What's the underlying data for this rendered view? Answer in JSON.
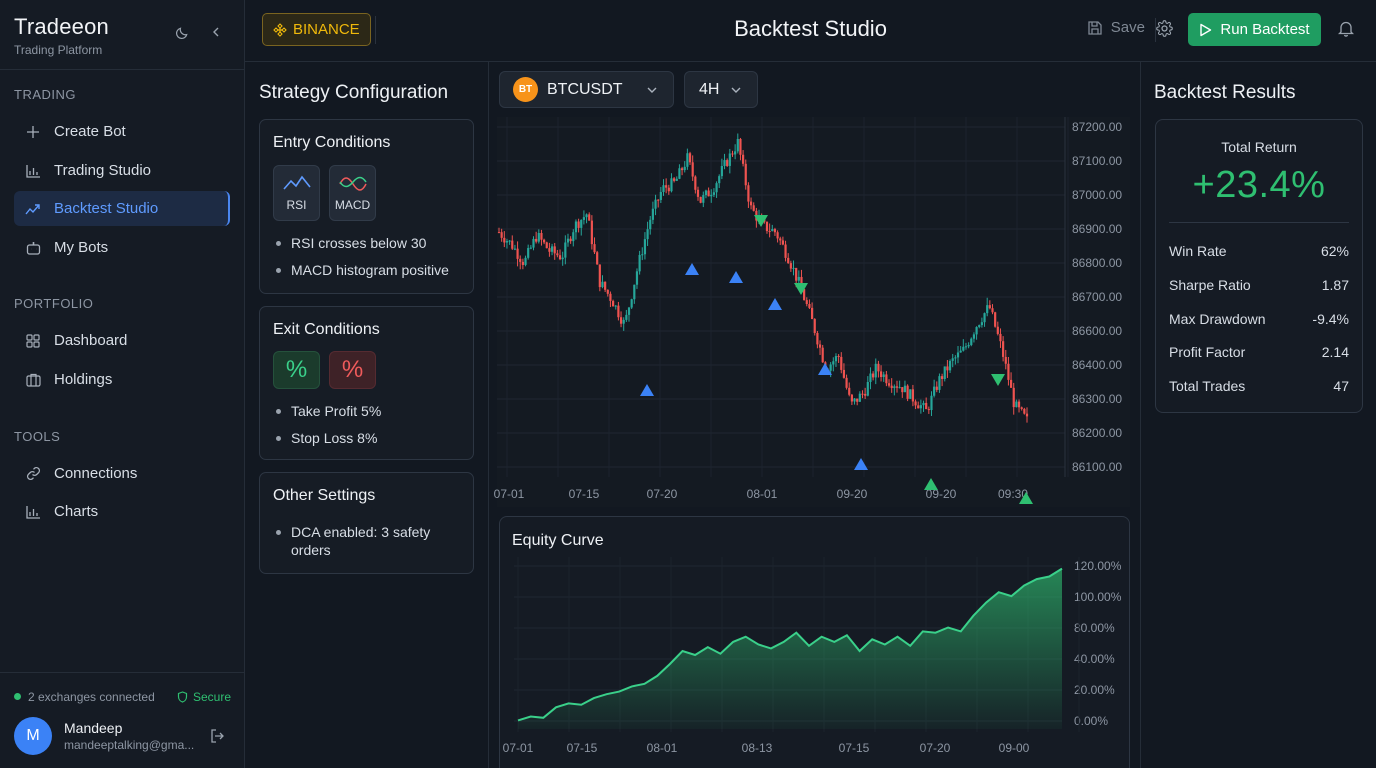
{
  "brand": {
    "name": "Tradeeon",
    "subtitle": "Trading Platform"
  },
  "sidebar": {
    "sections": [
      {
        "label": "TRADING"
      },
      {
        "label": "PORTFOLIO"
      },
      {
        "label": "TOOLS"
      }
    ],
    "items": [
      {
        "label": "Create Bot",
        "icon": "plus-icon"
      },
      {
        "label": "Trading Studio",
        "icon": "bar-chart-icon"
      },
      {
        "label": "Backtest Studio",
        "icon": "trend-line-icon",
        "active": true
      },
      {
        "label": "My Bots",
        "icon": "robot-icon"
      },
      {
        "label": "Dashboard",
        "icon": "grid-icon"
      },
      {
        "label": "Holdings",
        "icon": "wallet-icon"
      },
      {
        "label": "Connections",
        "icon": "link-icon"
      },
      {
        "label": "Charts",
        "icon": "bar-chart-icon"
      }
    ],
    "footer": {
      "connections": "2 exchanges connected",
      "secure": "Secure",
      "user": {
        "initial": "M",
        "name": "Mandeep",
        "email": "mandeeptalking@gma..."
      }
    }
  },
  "header": {
    "exchange": "BINANCE",
    "title": "Backtest Studio",
    "save_label": "Save",
    "run_label": "Run Backtest"
  },
  "strategy": {
    "title": "Strategy Configuration",
    "entry": {
      "title": "Entry Conditions",
      "indicators": [
        "RSI",
        "MACD"
      ],
      "rules": [
        "RSI crosses below 30",
        "MACD histogram positive"
      ]
    },
    "exit": {
      "title": "Exit Conditions",
      "symbols": [
        "%",
        "%"
      ],
      "rules": [
        "Take Profit 5%",
        "Stop Loss 8%"
      ]
    },
    "other": {
      "title": "Other Settings",
      "rules": [
        "DCA enabled: 3 safety orders"
      ]
    }
  },
  "chart": {
    "pair": "BTCUSDT",
    "coin_badge": "BT",
    "timeframe": "4H"
  },
  "results": {
    "title": "Backtest Results",
    "total_return_label": "Total Return",
    "total_return": "+23.4%",
    "metrics": [
      {
        "label": "Win Rate",
        "value": "62%"
      },
      {
        "label": "Sharpe Ratio",
        "value": "1.87"
      },
      {
        "label": "Max Drawdown",
        "value": "-9.4%"
      },
      {
        "label": "Profit Factor",
        "value": "2.14"
      },
      {
        "label": "Total Trades",
        "value": "47"
      }
    ]
  },
  "colors": {
    "accent": "#3b82f6",
    "up": "#26a69a",
    "down": "#ef5350",
    "brand_gold": "#f0b90b",
    "run": "#1f9d61"
  },
  "chart_data": [
    {
      "type": "candlestick",
      "title": "",
      "y_ticks": [
        "87200.00",
        "87100.00",
        "87000.00",
        "86900.00",
        "86800.00",
        "86700.00",
        "86600.00",
        "86400.00",
        "86300.00",
        "86200.00",
        "86100.00"
      ],
      "x_ticks": [
        "07-01",
        "07-15",
        "07-20",
        "08-01",
        "09-20",
        "09-20",
        "09:30"
      ],
      "close_path": [
        86860,
        86820,
        86760,
        86850,
        86800,
        86780,
        86880,
        86920,
        86700,
        86640,
        86560,
        86740,
        86900,
        87000,
        87020,
        87100,
        86960,
        87000,
        87080,
        87150,
        86940,
        86880,
        86860,
        86780,
        86680,
        86560,
        86420,
        86460,
        86300,
        86340,
        86420,
        86380,
        86360,
        86320,
        86280,
        86380,
        86440,
        86480,
        86560,
        86620,
        86480,
        86300,
        86250
      ],
      "buy_markers": 8,
      "sell_markers": 3
    },
    {
      "type": "area",
      "title": "Equity Curve",
      "y_ticks": [
        "120.00%",
        "100.00%",
        "80.00%",
        "40.00%",
        "20.00%",
        "0.00%"
      ],
      "x_ticks": [
        "07-01",
        "07-15",
        "08-01",
        "08-13",
        "07-15",
        "07-20",
        "09-00"
      ],
      "series": [
        {
          "values": [
            2,
            5,
            4,
            12,
            15,
            14,
            19,
            22,
            24,
            28,
            30,
            36,
            45,
            55,
            52,
            58,
            53,
            62,
            66,
            60,
            57,
            62,
            69,
            59,
            66,
            62,
            67,
            55,
            64,
            60,
            66,
            59,
            70,
            69,
            73,
            70,
            82,
            92,
            100,
            97,
            105,
            110,
            112,
            118
          ]
        }
      ]
    }
  ]
}
